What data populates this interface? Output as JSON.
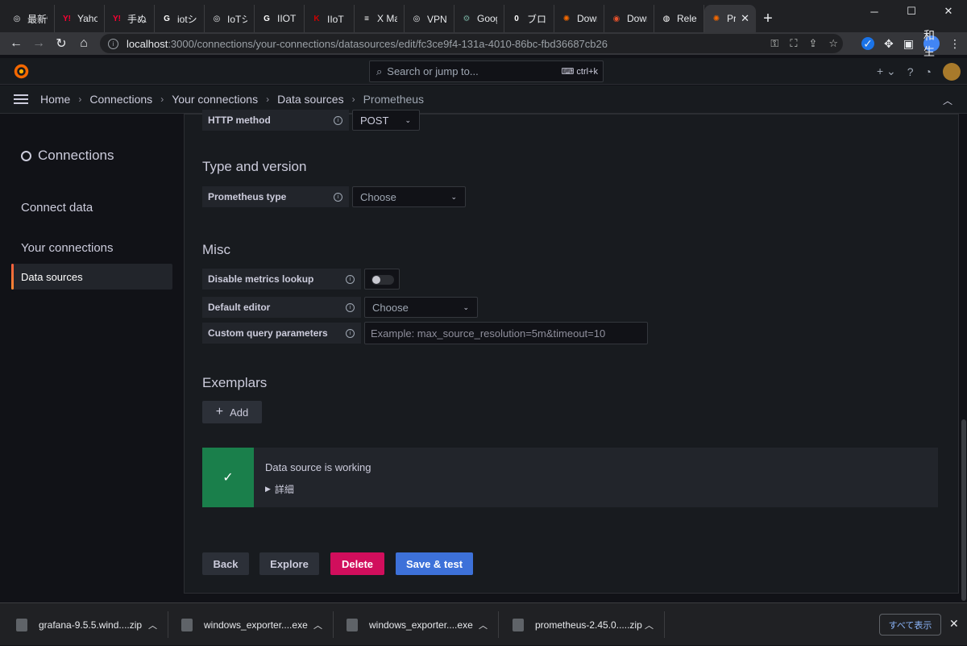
{
  "browser": {
    "tabs": [
      {
        "label": "最新情",
        "fav_color": "#e8eaed",
        "fav_glyph": "◎"
      },
      {
        "label": "Yahoo",
        "fav_color": "#ff0033",
        "fav_glyph": "Y!"
      },
      {
        "label": "手ぬぐ",
        "fav_color": "#ff0033",
        "fav_glyph": "Y!"
      },
      {
        "label": "iotシス",
        "fav_color": "#ffffff",
        "fav_glyph": "G"
      },
      {
        "label": "IoTシ",
        "fav_color": "#e8eaed",
        "fav_glyph": "◎"
      },
      {
        "label": "IIOT -",
        "fav_color": "#ffffff",
        "fav_glyph": "G"
      },
      {
        "label": "IIoT（",
        "fav_color": "#cc0000",
        "fav_glyph": "K"
      },
      {
        "label": "X Mar",
        "fav_color": "#ffffff",
        "fav_glyph": "≡"
      },
      {
        "label": "VPN接",
        "fav_color": "#e8eaed",
        "fav_glyph": "◎"
      },
      {
        "label": "Googl",
        "fav_color": "#74aa9c",
        "fav_glyph": "⚙"
      },
      {
        "label": "ブログ",
        "fav_color": "#ffffff",
        "fav_glyph": "0"
      },
      {
        "label": "Down",
        "fav_color": "#f46800",
        "fav_glyph": "✺"
      },
      {
        "label": "Down",
        "fav_color": "#e6522c",
        "fav_glyph": "◉"
      },
      {
        "label": "Releas",
        "fav_color": "#ffffff",
        "fav_glyph": "◍"
      }
    ],
    "active_tab": {
      "label": "Pr",
      "close": "✕"
    },
    "new_tab": "+",
    "window": {
      "minimize": "─",
      "maximize": "☐",
      "close": "✕"
    },
    "url_host": "localhost",
    "url_path": ":3000/connections/your-connections/datasources/edit/fc3ce9f4-131a-4010-86bc-fbd36687cb26",
    "profile_label": "和生"
  },
  "grafana": {
    "search_placeholder": "Search or jump to...",
    "search_shortcut": "ctrl+k",
    "breadcrumb": [
      "Home",
      "Connections",
      "Your connections",
      "Data sources",
      "Prometheus"
    ],
    "sidebar": {
      "title": "Connections",
      "items": [
        "Connect data",
        "Your connections",
        "Data sources"
      ]
    },
    "form": {
      "http_method_label": "HTTP method",
      "http_method_value": "POST",
      "type_version_heading": "Type and version",
      "prometheus_type_label": "Prometheus type",
      "prometheus_type_value": "Choose",
      "misc_heading": "Misc",
      "disable_metrics_label": "Disable metrics lookup",
      "default_editor_label": "Default editor",
      "default_editor_value": "Choose",
      "custom_query_label": "Custom query parameters",
      "custom_query_placeholder": "Example: max_source_resolution=5m&timeout=10",
      "exemplars_heading": "Exemplars",
      "add_label": "Add"
    },
    "alert": {
      "title": "Data source is working",
      "detail": "詳細"
    },
    "actions": {
      "back": "Back",
      "explore": "Explore",
      "delete": "Delete",
      "save_test": "Save & test"
    }
  },
  "downloads": {
    "items": [
      "grafana-9.5.5.wind....zip",
      "windows_exporter....exe",
      "windows_exporter....exe",
      "prometheus-2.45.0.....zip"
    ],
    "show_all": "すべて表示"
  }
}
